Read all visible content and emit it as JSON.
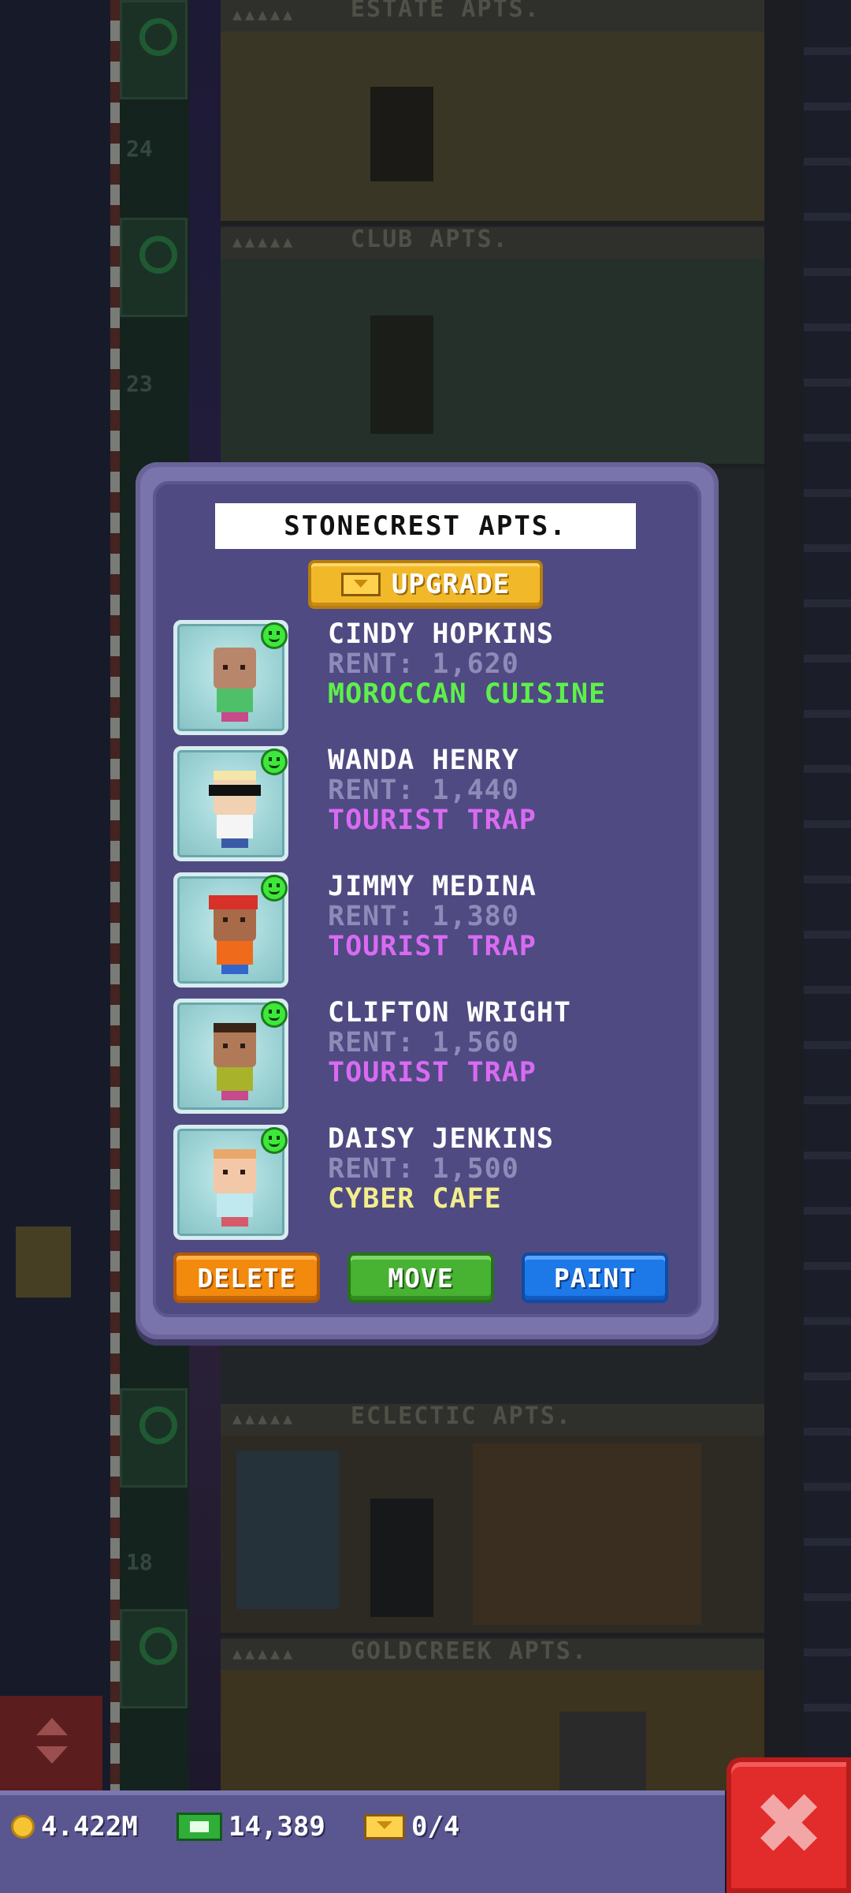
{
  "building": {
    "floor_labels": [
      "ESTATE APTS.",
      "CLUB APTS.",
      "ECLECTIC APTS.",
      "GOLDCREEK APTS."
    ],
    "floor_numbers": [
      "24",
      "23",
      "18"
    ]
  },
  "dialog": {
    "title": "STONECREST APTS.",
    "upgrade_label": "UPGRADE",
    "residents": [
      {
        "name": "CINDY HOPKINS",
        "rent": "RENT: 1,620",
        "job": "MOROCCAN CUISINE",
        "job_color": "#5ef04a"
      },
      {
        "name": "WANDA HENRY",
        "rent": "RENT: 1,440",
        "job": "TOURIST TRAP",
        "job_color": "#d96af2"
      },
      {
        "name": "JIMMY MEDINA",
        "rent": "RENT: 1,380",
        "job": "TOURIST TRAP",
        "job_color": "#d96af2"
      },
      {
        "name": "CLIFTON WRIGHT",
        "rent": "RENT: 1,560",
        "job": "TOURIST TRAP",
        "job_color": "#d96af2"
      },
      {
        "name": "DAISY JENKINS",
        "rent": "RENT: 1,500",
        "job": "CYBER CAFE",
        "job_color": "#f2ee8c"
      }
    ],
    "actions": {
      "delete": "DELETE",
      "move": "MOVE",
      "paint": "PAINT"
    }
  },
  "status_bar": {
    "coins": "4.422M",
    "cash": "14,389",
    "bux": "0/4"
  },
  "icons": {
    "close": "close-icon",
    "coin": "coin-icon",
    "cash": "cash-icon",
    "bux": "tower-bux-icon",
    "mood": "happy-face-icon"
  }
}
